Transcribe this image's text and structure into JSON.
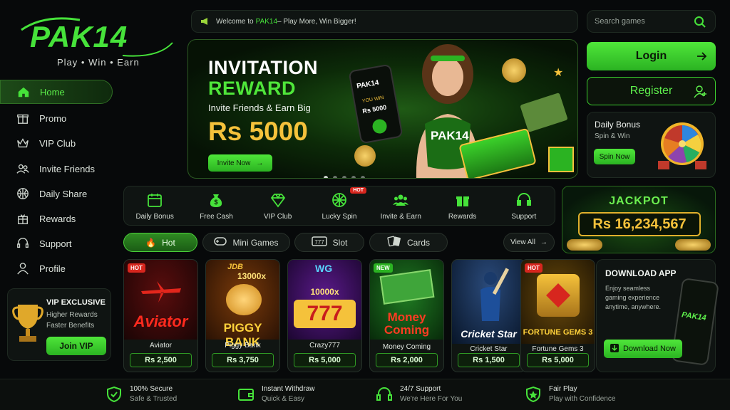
{
  "brand": {
    "logo": "PAK14",
    "tagline": "Play • Win • Earn"
  },
  "sidebar": {
    "items": [
      {
        "label": "Home",
        "icon": "home-icon"
      },
      {
        "label": "Promo",
        "icon": "gift-icon"
      },
      {
        "label": "VIP Club",
        "icon": "crown-icon"
      },
      {
        "label": "Invite Friends",
        "icon": "users-icon"
      },
      {
        "label": "Daily Share",
        "icon": "basketball-icon"
      },
      {
        "label": "Rewards",
        "icon": "reward-icon"
      },
      {
        "label": "Support",
        "icon": "headset-icon"
      },
      {
        "label": "Profile",
        "icon": "user-icon"
      }
    ]
  },
  "vip": {
    "title": "VIP EXCLUSIVE",
    "line1": "Higher Rewards",
    "line2": "Faster Benefits",
    "button": "Join VIP"
  },
  "ticker": {
    "prefix": "Welcome to ",
    "brand": "PAK14",
    "suffix": " – Play More, Win Bigger!"
  },
  "search": {
    "placeholder": "Search games"
  },
  "auth": {
    "login": "Login",
    "register": "Register"
  },
  "daily_bonus": {
    "title": "Daily Bonus",
    "subtitle": "Spin & Win",
    "button": "Spin Now"
  },
  "banner": {
    "title1": "INVITATION",
    "title2": "REWARD",
    "subtitle": "Invite Friends & Earn Big",
    "amount": "Rs 5000",
    "button": "Invite Now",
    "phone_logo": "PAK14",
    "phone_you_win": "YOU WIN",
    "phone_amount": "Rs 5000",
    "shirt": "PAK14",
    "slide_count": 5,
    "active_slide": 1
  },
  "quick": {
    "items": [
      {
        "label": "Daily Bonus",
        "icon": "calendar-icon"
      },
      {
        "label": "Free Cash",
        "icon": "money-bag-icon"
      },
      {
        "label": "VIP Club",
        "icon": "diamond-icon"
      },
      {
        "label": "Lucky Spin",
        "icon": "wheel-icon",
        "badge": "HOT"
      },
      {
        "label": "Invite & Earn",
        "icon": "users-icon"
      },
      {
        "label": "Rewards",
        "icon": "gift-icon"
      },
      {
        "label": "Support",
        "icon": "headset-icon"
      }
    ]
  },
  "jackpot": {
    "title": "JACKPOT",
    "amount": "Rs 16,234,567"
  },
  "tabs": {
    "items": [
      {
        "label": "Hot"
      },
      {
        "label": "Mini Games"
      },
      {
        "label": "Slot"
      },
      {
        "label": "Cards"
      }
    ],
    "view_all": "View All"
  },
  "games": [
    {
      "name": "Aviator",
      "art_text": "Aviator",
      "price": "Rs 2,500",
      "badge": "HOT"
    },
    {
      "name": "Piggy Bank",
      "art_text": "PIGGY BANK",
      "art_top": "13000x",
      "art_logo": "JDB",
      "price": "Rs 3,750",
      "badge": ""
    },
    {
      "name": "Crazy777",
      "art_text": "777",
      "art_top": "10000x",
      "art_logo": "WG",
      "price": "Rs 5,000",
      "badge": ""
    },
    {
      "name": "Money Coming",
      "art_text": "Money Coming",
      "price": "Rs 2,000",
      "badge": "NEW"
    },
    {
      "name": "Cricket Star",
      "art_text": "Cricket Star",
      "price": "Rs 1,500",
      "badge": ""
    },
    {
      "name": "Fortune Gems 3",
      "art_text": "FORTUNE GEMS 3",
      "price": "Rs 5,000",
      "badge": "HOT"
    }
  ],
  "download": {
    "title": "DOWNLOAD APP",
    "desc1": "Enjoy seamless",
    "desc2": "gaming experience",
    "desc3": "anytime, anywhere.",
    "button": "Download Now",
    "phone_logo": "PAK14"
  },
  "footer": {
    "items": [
      {
        "title": "100% Secure",
        "sub": "Safe & Trusted",
        "icon": "shield-icon"
      },
      {
        "title": "Instant Withdraw",
        "sub": "Quick & Easy",
        "icon": "wallet-icon"
      },
      {
        "title": "24/7 Support",
        "sub": "We're Here For You",
        "icon": "headset-icon"
      },
      {
        "title": "Fair Play",
        "sub": "Play with Confidence",
        "icon": "star-shield-icon"
      }
    ]
  }
}
